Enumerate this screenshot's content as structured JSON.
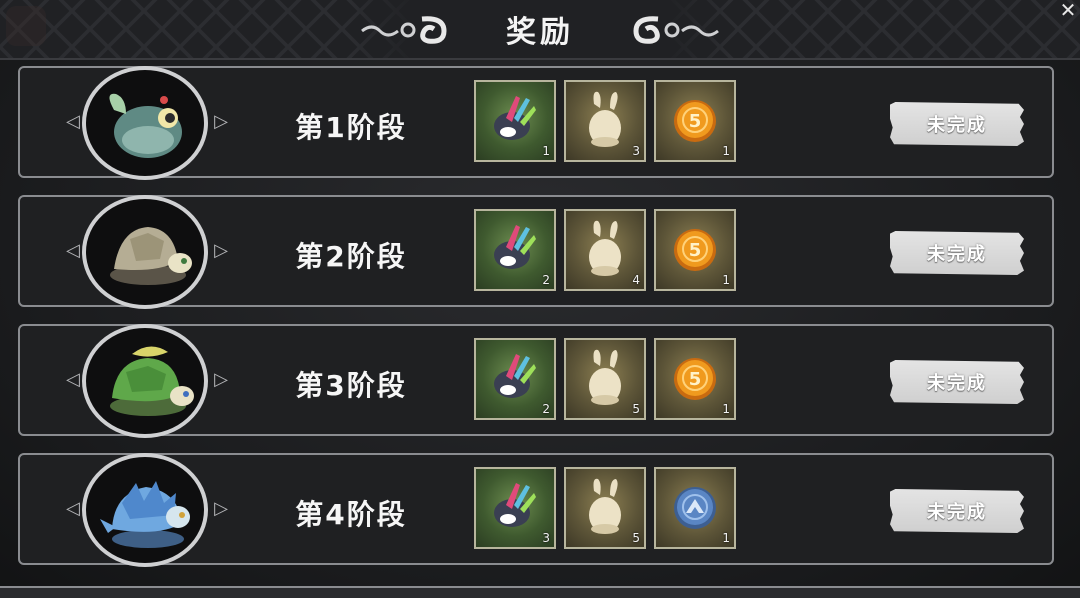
{
  "header": {
    "title": "奖励"
  },
  "stages": [
    {
      "label": "第1阶段",
      "pet": "green-fish-pet",
      "status": "未完成",
      "rewards": [
        {
          "icon": "rainbow-feather-icon",
          "qty": "1"
        },
        {
          "icon": "egg-icon",
          "qty": "3"
        },
        {
          "icon": "gold-coin-icon",
          "qty": "1"
        }
      ]
    },
    {
      "label": "第2阶段",
      "pet": "stone-turtle-pet",
      "status": "未完成",
      "rewards": [
        {
          "icon": "rainbow-feather-icon",
          "qty": "2"
        },
        {
          "icon": "egg-icon",
          "qty": "4"
        },
        {
          "icon": "gold-coin-icon",
          "qty": "1"
        }
      ]
    },
    {
      "label": "第3阶段",
      "pet": "leaf-turtle-pet",
      "status": "未完成",
      "rewards": [
        {
          "icon": "rainbow-feather-icon",
          "qty": "2"
        },
        {
          "icon": "egg-icon",
          "qty": "5"
        },
        {
          "icon": "gold-coin-icon",
          "qty": "1"
        }
      ]
    },
    {
      "label": "第4阶段",
      "pet": "blue-crystal-turtle-pet",
      "status": "未完成",
      "rewards": [
        {
          "icon": "rainbow-feather-icon",
          "qty": "3"
        },
        {
          "icon": "egg-icon",
          "qty": "5"
        },
        {
          "icon": "blue-coin-icon",
          "qty": "1"
        }
      ]
    }
  ],
  "colors": {
    "coin_gold": "#f09a1e",
    "coin_blue": "#5a86c4",
    "feather_bg": "#4d6b3a",
    "egg_bg": "#6b6240",
    "status_button": "#d9d9d9"
  }
}
